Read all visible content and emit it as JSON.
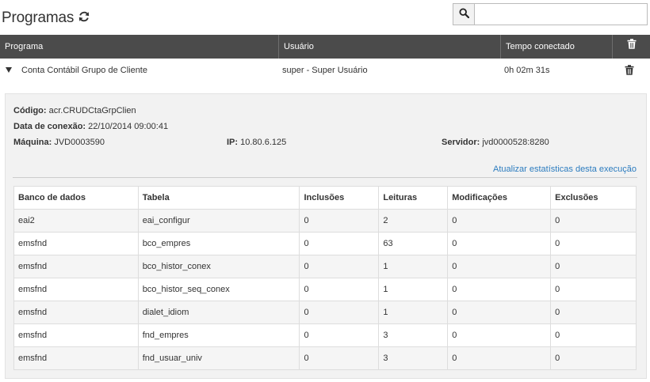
{
  "header": {
    "title": "Programas",
    "search_placeholder": ""
  },
  "main_table": {
    "columns": [
      "Programa",
      "Usuário",
      "Tempo conectado"
    ],
    "row": {
      "programa": "Conta Contábil Grupo de Cliente",
      "usuario": "super - Super Usuário",
      "tempo": "0h 02m 31s"
    }
  },
  "details": {
    "codigo_label": "Código:",
    "codigo_value": "acr.CRUDCtaGrpClien",
    "data_label": "Data de conexão:",
    "data_value": "22/10/2014 09:00:41",
    "maquina_label": "Máquina:",
    "maquina_value": "JVD0003590",
    "ip_label": "IP:",
    "ip_value": "10.80.6.125",
    "servidor_label": "Servidor:",
    "servidor_value": "jvd0000528:8280",
    "stats_link": "Atualizar estatísticas desta execução"
  },
  "db_table": {
    "columns": [
      "Banco de dados",
      "Tabela",
      "Inclusões",
      "Leituras",
      "Modificações",
      "Exclusões"
    ],
    "rows": [
      [
        "eai2",
        "eai_configur",
        "0",
        "2",
        "0",
        "0"
      ],
      [
        "emsfnd",
        "bco_empres",
        "0",
        "63",
        "0",
        "0"
      ],
      [
        "emsfnd",
        "bco_histor_conex",
        "0",
        "1",
        "0",
        "0"
      ],
      [
        "emsfnd",
        "bco_histor_seq_conex",
        "0",
        "1",
        "0",
        "0"
      ],
      [
        "emsfnd",
        "dialet_idiom",
        "0",
        "1",
        "0",
        "0"
      ],
      [
        "emsfnd",
        "fnd_empres",
        "0",
        "3",
        "0",
        "0"
      ],
      [
        "emsfnd",
        "fnd_usuar_univ",
        "0",
        "3",
        "0",
        "0"
      ]
    ]
  },
  "colors": {
    "header_bg": "#4b4b4b",
    "link": "#2c7cbf",
    "details_bg": "#f2f2f2"
  }
}
